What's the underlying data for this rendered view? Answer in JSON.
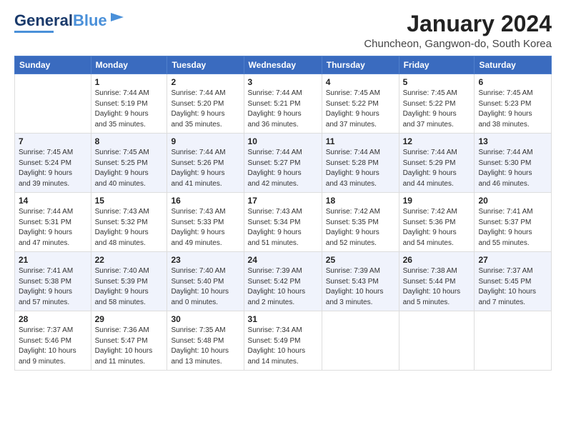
{
  "header": {
    "logo_general": "General",
    "logo_blue": "Blue",
    "month_title": "January 2024",
    "subtitle": "Chuncheon, Gangwon-do, South Korea"
  },
  "columns": [
    "Sunday",
    "Monday",
    "Tuesday",
    "Wednesday",
    "Thursday",
    "Friday",
    "Saturday"
  ],
  "weeks": [
    [
      {
        "day": "",
        "info": ""
      },
      {
        "day": "1",
        "info": "Sunrise: 7:44 AM\nSunset: 5:19 PM\nDaylight: 9 hours\nand 35 minutes."
      },
      {
        "day": "2",
        "info": "Sunrise: 7:44 AM\nSunset: 5:20 PM\nDaylight: 9 hours\nand 35 minutes."
      },
      {
        "day": "3",
        "info": "Sunrise: 7:44 AM\nSunset: 5:21 PM\nDaylight: 9 hours\nand 36 minutes."
      },
      {
        "day": "4",
        "info": "Sunrise: 7:45 AM\nSunset: 5:22 PM\nDaylight: 9 hours\nand 37 minutes."
      },
      {
        "day": "5",
        "info": "Sunrise: 7:45 AM\nSunset: 5:22 PM\nDaylight: 9 hours\nand 37 minutes."
      },
      {
        "day": "6",
        "info": "Sunrise: 7:45 AM\nSunset: 5:23 PM\nDaylight: 9 hours\nand 38 minutes."
      }
    ],
    [
      {
        "day": "7",
        "info": "Sunrise: 7:45 AM\nSunset: 5:24 PM\nDaylight: 9 hours\nand 39 minutes."
      },
      {
        "day": "8",
        "info": "Sunrise: 7:45 AM\nSunset: 5:25 PM\nDaylight: 9 hours\nand 40 minutes."
      },
      {
        "day": "9",
        "info": "Sunrise: 7:44 AM\nSunset: 5:26 PM\nDaylight: 9 hours\nand 41 minutes."
      },
      {
        "day": "10",
        "info": "Sunrise: 7:44 AM\nSunset: 5:27 PM\nDaylight: 9 hours\nand 42 minutes."
      },
      {
        "day": "11",
        "info": "Sunrise: 7:44 AM\nSunset: 5:28 PM\nDaylight: 9 hours\nand 43 minutes."
      },
      {
        "day": "12",
        "info": "Sunrise: 7:44 AM\nSunset: 5:29 PM\nDaylight: 9 hours\nand 44 minutes."
      },
      {
        "day": "13",
        "info": "Sunrise: 7:44 AM\nSunset: 5:30 PM\nDaylight: 9 hours\nand 46 minutes."
      }
    ],
    [
      {
        "day": "14",
        "info": "Sunrise: 7:44 AM\nSunset: 5:31 PM\nDaylight: 9 hours\nand 47 minutes."
      },
      {
        "day": "15",
        "info": "Sunrise: 7:43 AM\nSunset: 5:32 PM\nDaylight: 9 hours\nand 48 minutes."
      },
      {
        "day": "16",
        "info": "Sunrise: 7:43 AM\nSunset: 5:33 PM\nDaylight: 9 hours\nand 49 minutes."
      },
      {
        "day": "17",
        "info": "Sunrise: 7:43 AM\nSunset: 5:34 PM\nDaylight: 9 hours\nand 51 minutes."
      },
      {
        "day": "18",
        "info": "Sunrise: 7:42 AM\nSunset: 5:35 PM\nDaylight: 9 hours\nand 52 minutes."
      },
      {
        "day": "19",
        "info": "Sunrise: 7:42 AM\nSunset: 5:36 PM\nDaylight: 9 hours\nand 54 minutes."
      },
      {
        "day": "20",
        "info": "Sunrise: 7:41 AM\nSunset: 5:37 PM\nDaylight: 9 hours\nand 55 minutes."
      }
    ],
    [
      {
        "day": "21",
        "info": "Sunrise: 7:41 AM\nSunset: 5:38 PM\nDaylight: 9 hours\nand 57 minutes."
      },
      {
        "day": "22",
        "info": "Sunrise: 7:40 AM\nSunset: 5:39 PM\nDaylight: 9 hours\nand 58 minutes."
      },
      {
        "day": "23",
        "info": "Sunrise: 7:40 AM\nSunset: 5:40 PM\nDaylight: 10 hours\nand 0 minutes."
      },
      {
        "day": "24",
        "info": "Sunrise: 7:39 AM\nSunset: 5:42 PM\nDaylight: 10 hours\nand 2 minutes."
      },
      {
        "day": "25",
        "info": "Sunrise: 7:39 AM\nSunset: 5:43 PM\nDaylight: 10 hours\nand 3 minutes."
      },
      {
        "day": "26",
        "info": "Sunrise: 7:38 AM\nSunset: 5:44 PM\nDaylight: 10 hours\nand 5 minutes."
      },
      {
        "day": "27",
        "info": "Sunrise: 7:37 AM\nSunset: 5:45 PM\nDaylight: 10 hours\nand 7 minutes."
      }
    ],
    [
      {
        "day": "28",
        "info": "Sunrise: 7:37 AM\nSunset: 5:46 PM\nDaylight: 10 hours\nand 9 minutes."
      },
      {
        "day": "29",
        "info": "Sunrise: 7:36 AM\nSunset: 5:47 PM\nDaylight: 10 hours\nand 11 minutes."
      },
      {
        "day": "30",
        "info": "Sunrise: 7:35 AM\nSunset: 5:48 PM\nDaylight: 10 hours\nand 13 minutes."
      },
      {
        "day": "31",
        "info": "Sunrise: 7:34 AM\nSunset: 5:49 PM\nDaylight: 10 hours\nand 14 minutes."
      },
      {
        "day": "",
        "info": ""
      },
      {
        "day": "",
        "info": ""
      },
      {
        "day": "",
        "info": ""
      }
    ]
  ]
}
